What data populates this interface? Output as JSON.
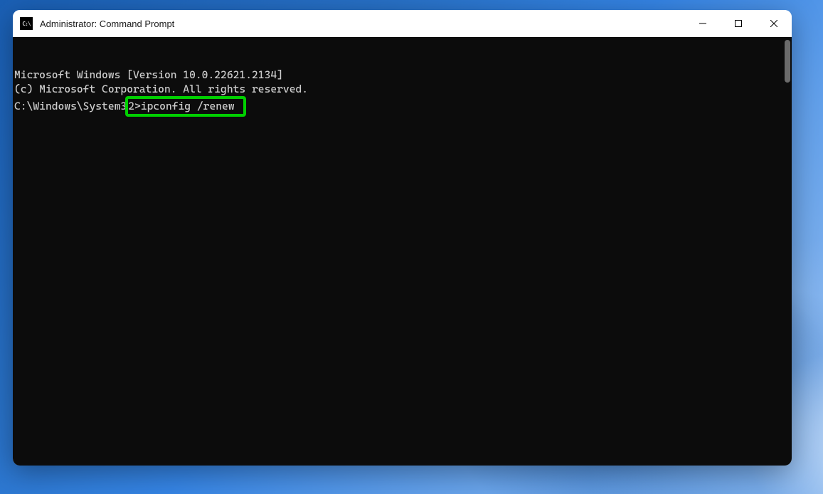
{
  "window": {
    "title": "Administrator: Command Prompt"
  },
  "terminal": {
    "line1": "Microsoft Windows [Version 10.0.22621.2134]",
    "line2": "(c) Microsoft Corporation. All rights reserved.",
    "blank": "",
    "prompt_prefix": "C:\\Windows\\System3",
    "highlighted_part": "2>ipconfig /renew "
  }
}
